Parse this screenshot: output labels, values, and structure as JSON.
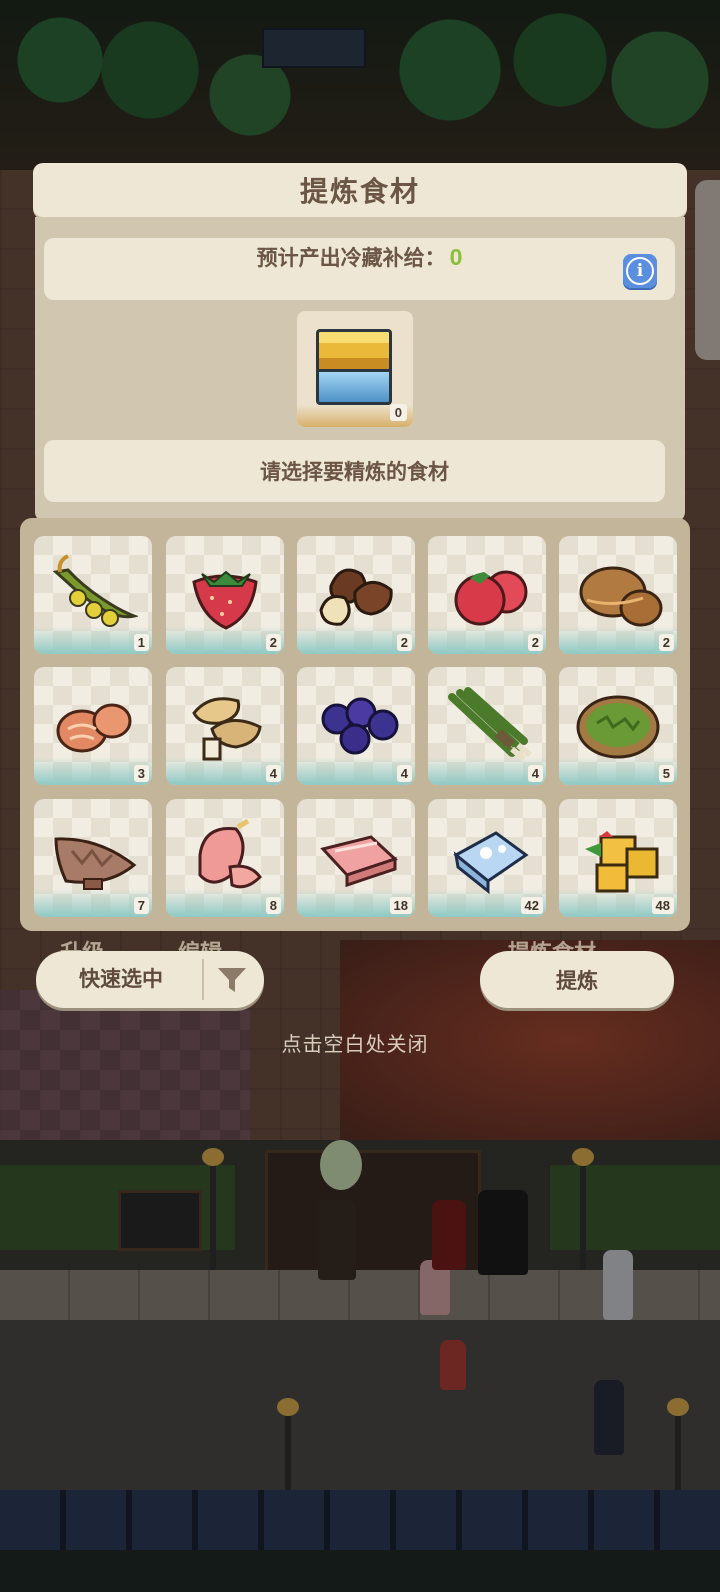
{
  "dialog": {
    "title": "提炼食材",
    "forecast_label": "预计产出冷藏补给：",
    "forecast_value": "0",
    "info_icon_glyph": "i",
    "product": {
      "icon": "cold-supply-crate-icon",
      "count": "0"
    },
    "prompt": "请选择要精炼的食材"
  },
  "inventory": [
    {
      "icon": "pea-pod-icon",
      "count": "1"
    },
    {
      "icon": "strawberry-icon",
      "count": "2"
    },
    {
      "icon": "chestnut-icon",
      "count": "2"
    },
    {
      "icon": "tomato-icon",
      "count": "2"
    },
    {
      "icon": "bread-bun-icon",
      "count": "2"
    },
    {
      "icon": "shrimp-meat-icon",
      "count": "3"
    },
    {
      "icon": "mushroom-icon",
      "count": "4"
    },
    {
      "icon": "blueberry-icon",
      "count": "4"
    },
    {
      "icon": "green-onion-icon",
      "count": "4"
    },
    {
      "icon": "seaweed-plate-icon",
      "count": "5"
    },
    {
      "icon": "fish-fillet-icon",
      "count": "7"
    },
    {
      "icon": "peach-icon",
      "count": "8"
    },
    {
      "icon": "bacon-icon",
      "count": "18"
    },
    {
      "icon": "milk-carton-icon",
      "count": "42"
    },
    {
      "icon": "cheese-icon",
      "count": "48"
    }
  ],
  "background_labels": {
    "upgrade": "升级",
    "edit": "编辑",
    "refine_ingredients": "提炼食材"
  },
  "actions": {
    "quick_select": "快速选中",
    "filter_icon": "filter-icon",
    "refine": "提炼",
    "close_hint": "点击空白处关闭"
  },
  "colors": {
    "forecast_value": "#8bbf3a",
    "info_button": "#5a8fe0",
    "panel": "#d1c7b1",
    "card": "#efe7d5"
  }
}
